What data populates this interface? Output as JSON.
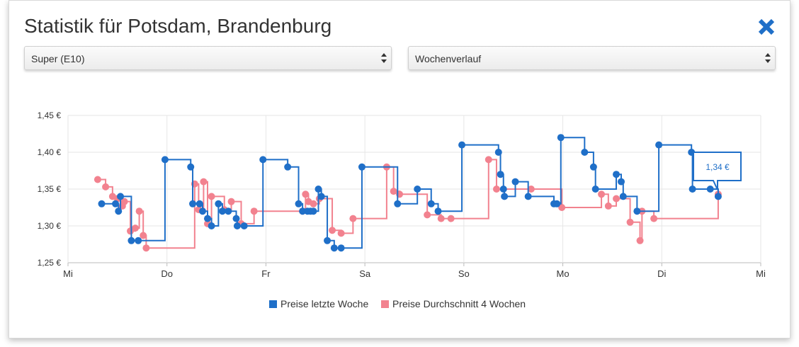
{
  "dialog": {
    "title": "Statistik für Potsdam, Brandenburg",
    "close_icon": "close-x-icon"
  },
  "controls": {
    "fuel_select": {
      "value": "Super (E10)"
    },
    "range_select": {
      "value": "Wochenverlauf"
    }
  },
  "colors": {
    "blue": "#1f6fc8",
    "pink": "#f2828f",
    "grid": "#e6e6e6"
  },
  "chart_data": {
    "type": "line",
    "step": true,
    "y_unit": "€",
    "ylim": [
      1.25,
      1.45
    ],
    "y_ticks": [
      {
        "value": 1.25,
        "label": "1,25 €"
      },
      {
        "value": 1.3,
        "label": "1,30 €"
      },
      {
        "value": 1.35,
        "label": "1,35 €"
      },
      {
        "value": 1.4,
        "label": "1,40 €"
      },
      {
        "value": 1.45,
        "label": "1,45 €"
      }
    ],
    "xlim": [
      0,
      7
    ],
    "x_ticks": [
      {
        "value": 0,
        "label": "Mi"
      },
      {
        "value": 1,
        "label": "Do"
      },
      {
        "value": 2,
        "label": "Fr"
      },
      {
        "value": 3,
        "label": "Sa"
      },
      {
        "value": 4,
        "label": "So"
      },
      {
        "value": 5,
        "label": "Mo"
      },
      {
        "value": 6,
        "label": "Di"
      },
      {
        "value": 7,
        "label": "Mi"
      }
    ],
    "grid": true,
    "legend_position": "bottom",
    "series": [
      {
        "name": "Preise letzte Woche",
        "color": "#1f6fc8",
        "points": [
          [
            0.34,
            1.33
          ],
          [
            0.48,
            1.33
          ],
          [
            0.51,
            1.32
          ],
          [
            0.53,
            1.34
          ],
          [
            0.64,
            1.28
          ],
          [
            0.71,
            1.28
          ],
          [
            0.98,
            1.39
          ],
          [
            1.24,
            1.38
          ],
          [
            1.26,
            1.33
          ],
          [
            1.33,
            1.33
          ],
          [
            1.36,
            1.32
          ],
          [
            1.41,
            1.31
          ],
          [
            1.45,
            1.3
          ],
          [
            1.52,
            1.33
          ],
          [
            1.56,
            1.32
          ],
          [
            1.62,
            1.32
          ],
          [
            1.7,
            1.31
          ],
          [
            1.71,
            1.3
          ],
          [
            1.78,
            1.3
          ],
          [
            1.97,
            1.39
          ],
          [
            2.22,
            1.38
          ],
          [
            2.33,
            1.33
          ],
          [
            2.37,
            1.32
          ],
          [
            2.42,
            1.32
          ],
          [
            2.45,
            1.32
          ],
          [
            2.48,
            1.32
          ],
          [
            2.53,
            1.35
          ],
          [
            2.56,
            1.34
          ],
          [
            2.62,
            1.28
          ],
          [
            2.69,
            1.27
          ],
          [
            2.76,
            1.27
          ],
          [
            2.97,
            1.38
          ],
          [
            3.33,
            1.33
          ],
          [
            3.53,
            1.35
          ],
          [
            3.67,
            1.33
          ],
          [
            3.74,
            1.32
          ],
          [
            3.98,
            1.41
          ],
          [
            4.35,
            1.4
          ],
          [
            4.37,
            1.37
          ],
          [
            4.4,
            1.35
          ],
          [
            4.41,
            1.34
          ],
          [
            4.52,
            1.36
          ],
          [
            4.65,
            1.34
          ],
          [
            4.91,
            1.33
          ],
          [
            4.94,
            1.33
          ],
          [
            4.98,
            1.42
          ],
          [
            5.22,
            1.4
          ],
          [
            5.31,
            1.38
          ],
          [
            5.33,
            1.35
          ],
          [
            5.54,
            1.37
          ],
          [
            5.59,
            1.36
          ],
          [
            5.61,
            1.34
          ],
          [
            5.75,
            1.32
          ],
          [
            5.97,
            1.41
          ],
          [
            6.3,
            1.4
          ],
          [
            6.31,
            1.35
          ],
          [
            6.49,
            1.35
          ],
          [
            6.57,
            1.34
          ]
        ]
      },
      {
        "name": "Preise Durchschnitt 4 Wochen",
        "color": "#f2828f",
        "points": [
          [
            0.3,
            1.363
          ],
          [
            0.38,
            1.353
          ],
          [
            0.45,
            1.34
          ],
          [
            0.5,
            1.337
          ],
          [
            0.55,
            1.327
          ],
          [
            0.57,
            1.333
          ],
          [
            0.63,
            1.293
          ],
          [
            0.68,
            1.297
          ],
          [
            0.72,
            1.32
          ],
          [
            0.76,
            1.287
          ],
          [
            0.79,
            1.27
          ],
          [
            1.28,
            1.357
          ],
          [
            1.32,
            1.322
          ],
          [
            1.37,
            1.36
          ],
          [
            1.41,
            1.303
          ],
          [
            1.45,
            1.34
          ],
          [
            1.58,
            1.322
          ],
          [
            1.65,
            1.333
          ],
          [
            1.75,
            1.303
          ],
          [
            1.88,
            1.32
          ],
          [
            2.37,
            1.32
          ],
          [
            2.4,
            1.343
          ],
          [
            2.43,
            1.333
          ],
          [
            2.48,
            1.33
          ],
          [
            2.54,
            1.337
          ],
          [
            2.67,
            1.294
          ],
          [
            2.76,
            1.29
          ],
          [
            2.88,
            1.31
          ],
          [
            3.22,
            1.38
          ],
          [
            3.29,
            1.347
          ],
          [
            3.35,
            1.343
          ],
          [
            3.63,
            1.315
          ],
          [
            3.77,
            1.31
          ],
          [
            3.87,
            1.31
          ],
          [
            4.25,
            1.39
          ],
          [
            4.33,
            1.35
          ],
          [
            4.68,
            1.35
          ],
          [
            4.99,
            1.325
          ],
          [
            5.39,
            1.343
          ],
          [
            5.46,
            1.327
          ],
          [
            5.54,
            1.337
          ],
          [
            5.68,
            1.305
          ],
          [
            5.78,
            1.28
          ],
          [
            5.8,
            1.32
          ],
          [
            5.92,
            1.31
          ],
          [
            6.57,
            1.343
          ]
        ]
      }
    ],
    "tooltip": {
      "value": 1.34,
      "text": "1,34 €",
      "series": "Preise letzte Woche"
    }
  }
}
